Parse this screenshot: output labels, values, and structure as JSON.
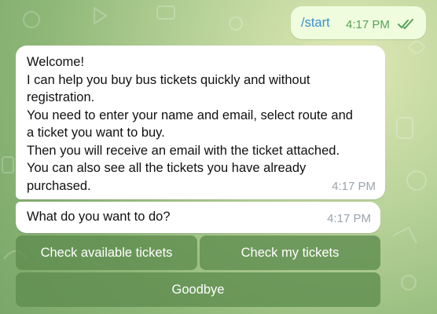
{
  "colors": {
    "background": "#a9c98a",
    "outgoing_bubble": "#effdde",
    "incoming_bubble": "#ffffff",
    "command_link": "#3b8fcf",
    "keyboard_button": "#5d8c4e"
  },
  "outgoing": {
    "text": "/start",
    "time": "4:17 PM",
    "status_icon": "double-check-icon"
  },
  "messages": [
    {
      "lines": [
        "Welcome!",
        "I can help you buy bus tickets quickly and without",
        "registration.",
        "You need to enter your name and email, select route and",
        "a ticket you want to buy.",
        "Then you will receive an email with the ticket attached.",
        "You can also see all the tickets you have already",
        "purchased."
      ],
      "time": "4:17 PM"
    },
    {
      "lines": [
        "What do you want to do?"
      ],
      "time": "4:17 PM"
    }
  ],
  "keyboard": {
    "buttons": [
      "Check available tickets",
      "Check my tickets",
      "Goodbye"
    ]
  }
}
